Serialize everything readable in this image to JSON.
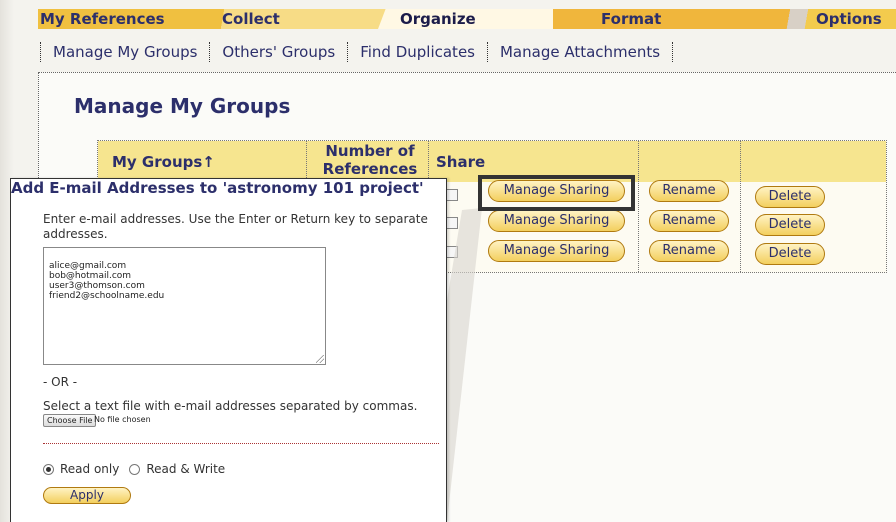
{
  "topnav": {
    "tabs": [
      {
        "label": "My References"
      },
      {
        "label": "Collect"
      },
      {
        "label": "Organize"
      },
      {
        "label": "Format"
      },
      {
        "label": "Options"
      }
    ]
  },
  "subnav": {
    "items": [
      {
        "label": "Manage My Groups"
      },
      {
        "label": "Others' Groups"
      },
      {
        "label": "Find Duplicates"
      },
      {
        "label": "Manage Attachments"
      }
    ]
  },
  "page": {
    "title": "Manage My Groups"
  },
  "groups_table": {
    "headers": {
      "my_groups": "My Groups",
      "my_groups_sort_glyph": "↑",
      "num_refs_line1": "Number of",
      "num_refs_line2": "References",
      "share": "Share"
    },
    "rows": [
      {
        "manage_sharing": "Manage Sharing",
        "rename": "Rename",
        "delete": "Delete"
      },
      {
        "manage_sharing": "Manage Sharing",
        "rename": "Rename",
        "delete": "Delete"
      },
      {
        "manage_sharing": "Manage Sharing",
        "rename": "Rename",
        "delete": "Delete"
      }
    ]
  },
  "dialog": {
    "title": "Add E-mail Addresses to 'astronomy 101 project'",
    "instructions": "Enter e-mail addresses. Use the Enter or Return key to separate addresses.",
    "emails": "alice@gmail.com\nbob@hotmail.com\nuser3@thomson.com\nfriend2@schoolname.edu",
    "or_text": "- OR -",
    "file_label": "Select a text file with e-mail addresses separated by commas.",
    "choose_file": "Choose File",
    "no_file": "No file chosen",
    "read_only": "Read only",
    "read_write": "Read & Write",
    "apply": "Apply"
  },
  "colors": {
    "nav_gold": "#f0c040",
    "header_yellow": "#f6e58f",
    "text_navy": "#2c2f6b",
    "button_border": "#b07a10"
  }
}
